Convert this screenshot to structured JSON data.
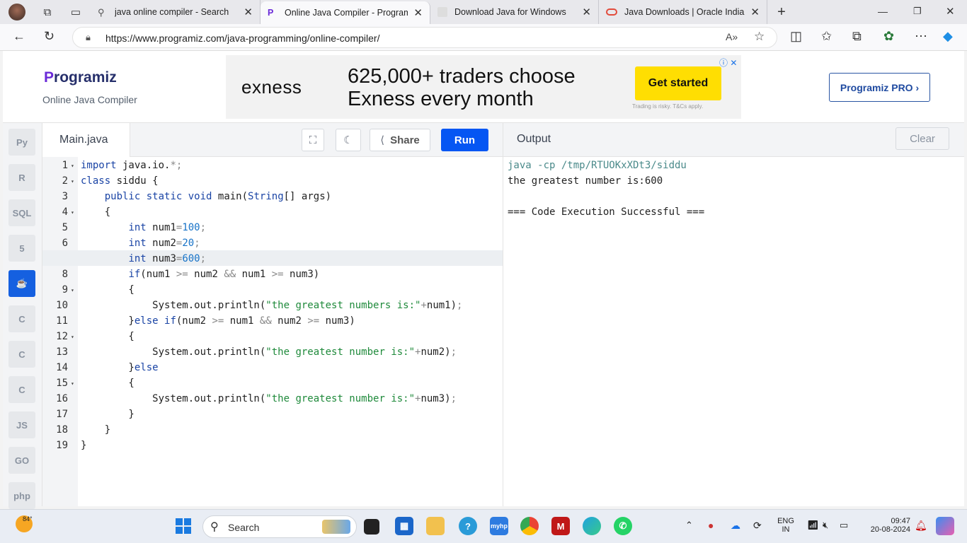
{
  "browser": {
    "tabs": [
      {
        "title": "java online compiler - Search"
      },
      {
        "title": "Online Java Compiler - Programiz"
      },
      {
        "title": "Download Java for Windows"
      },
      {
        "title": "Java Downloads | Oracle India"
      }
    ],
    "url": "https://www.programiz.com/java-programming/online-compiler/"
  },
  "header": {
    "logo_mark": "P",
    "logo_rest": "rogramiz",
    "subtitle": "Online Java Compiler",
    "pro_button": "Programiz PRO ›"
  },
  "ad": {
    "brand": "exness",
    "line1": "625,000+ traders choose",
    "line2": "Exness every month",
    "button": "Get started",
    "disclaimer": "Trading is risky. T&Cs apply.",
    "info": "ⓘ ✕"
  },
  "languages": [
    {
      "name": "python-icon",
      "label": "Py"
    },
    {
      "name": "r-icon",
      "label": "R"
    },
    {
      "name": "sql-icon",
      "label": "SQL"
    },
    {
      "name": "html5-icon",
      "label": "5"
    },
    {
      "name": "java-icon",
      "label": "☕"
    },
    {
      "name": "c-icon",
      "label": "C"
    },
    {
      "name": "cpp-icon",
      "label": "C"
    },
    {
      "name": "csharp-icon",
      "label": "C"
    },
    {
      "name": "js-icon",
      "label": "JS"
    },
    {
      "name": "go-icon",
      "label": "GO"
    },
    {
      "name": "php-icon",
      "label": "php"
    }
  ],
  "editor": {
    "filename": "Main.java",
    "share_label": "Share",
    "run_label": "Run",
    "lines": [
      "import java.io.*;",
      "class siddu {",
      "    public static void main(String[] args)",
      "    {",
      "        int num1=100;",
      "        int num2=20;",
      "        int num3=600;",
      "        if(num1 >= num2 && num1 >= num3)",
      "        {",
      "            System.out.println(\"the greatest numbers is:\"+num1);",
      "        }else if(num2 >= num1 && num2 >= num3)",
      "        {",
      "            System.out.println(\"the greatest number is:\"+num2);",
      "        }else",
      "        {",
      "            System.out.println(\"the greatest number is:\"+num3);",
      "        }",
      "    }",
      "}"
    ],
    "fold_lines": [
      1,
      2,
      4,
      9,
      12,
      15
    ]
  },
  "output": {
    "title": "Output",
    "clear_label": "Clear",
    "lines": [
      "java -cp /tmp/RTUOKxXDt3/siddu",
      "the greatest number is:600",
      "",
      "=== Code Execution Successful ==="
    ]
  },
  "taskbar": {
    "weather": "84°",
    "search_placeholder": "Search",
    "lang_line1": "ENG",
    "lang_line2": "IN",
    "time": "09:47",
    "date": "20-08-2024"
  }
}
